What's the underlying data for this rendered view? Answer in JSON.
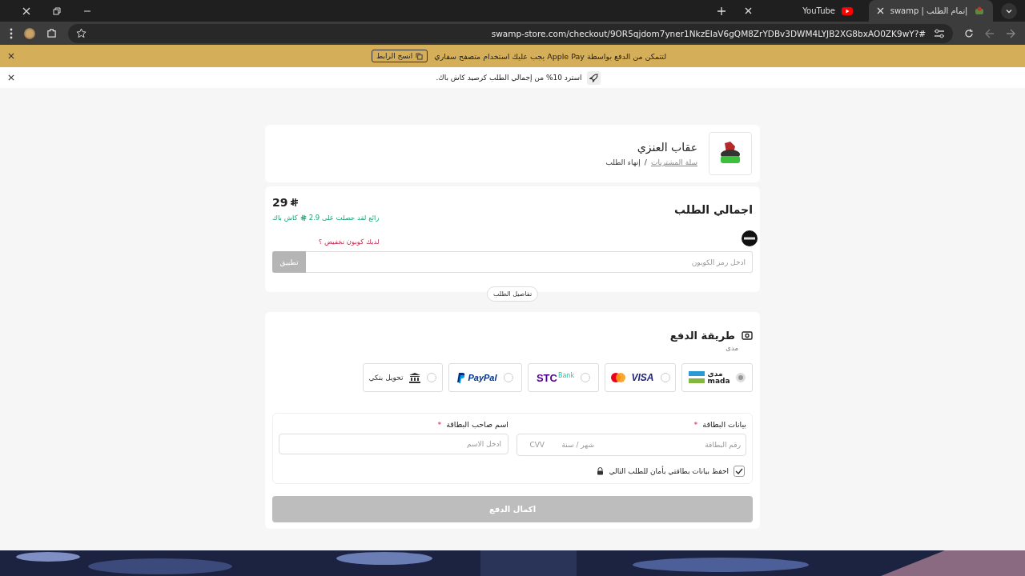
{
  "browser": {
    "tabs": [
      {
        "title": "إتمام الطلب | swamp",
        "selected": true
      },
      {
        "title": "YouTube",
        "selected": false
      }
    ],
    "url": "swamp-store.com/checkout/9OR5qjdom7yner1NkzEIaV6gQM8ZrYDBv3DWM4LYJB2XG8bxAO0ZK9wY?#"
  },
  "banner": {
    "text": "لتتمكن من الدفع بواسطة Apple Pay يجب عليك استخدام متصفح سفاري",
    "button": "انسخ الرابط"
  },
  "notice": {
    "text": "استرد 10% من إجمالي الطلب كرصيد كاش باك."
  },
  "store": {
    "name": "عقاب العنزي",
    "breadcrumb": [
      {
        "label": "سلة المشتريات",
        "link": true
      },
      {
        "label": "إنهاء الطلب",
        "link": false
      }
    ],
    "separator": "/"
  },
  "summary": {
    "title": "اجمالي الطلب",
    "total": "29",
    "cashback_before": "رائع لقد حصلت على 2.9",
    "cashback_after": "كاش باك",
    "coupon_link": "لديك كوبون تخفيض ؟",
    "coupon_placeholder": "ادخل رمز الكوبون",
    "apply_button": "تطبيق",
    "details_button": "تفاصيل الطلب"
  },
  "payment": {
    "title": "طريقة الدفع",
    "subtitle": "مدى",
    "methods": [
      {
        "kind": "mada",
        "texts": [
          "مدى",
          "mada"
        ],
        "selected": true
      },
      {
        "kind": "visa",
        "texts": [
          "VISA"
        ],
        "selected": false
      },
      {
        "kind": "stc",
        "texts": [
          "STC",
          "Bank"
        ],
        "selected": false
      },
      {
        "kind": "paypal",
        "texts": [
          "PayPal"
        ],
        "selected": false
      },
      {
        "kind": "bank",
        "texts": [
          "تحويل بنكي"
        ],
        "selected": false
      }
    ]
  },
  "card_form": {
    "card_label": "بيانات البطاقة",
    "name_label": "اسم صاحب البطاقة",
    "required_mark": "*",
    "card_number_placeholder": "رقم البطاقة",
    "expiry_placeholder": "شهر / سنة",
    "cvv_placeholder": "CVV",
    "name_placeholder": "ادخل الاسم",
    "save_card": {
      "label": "احفظ بيانات بطاقتي بأمان للطلب التالي",
      "checked": true
    }
  },
  "submit": {
    "label": "اكمال الدفع",
    "disabled": true
  }
}
